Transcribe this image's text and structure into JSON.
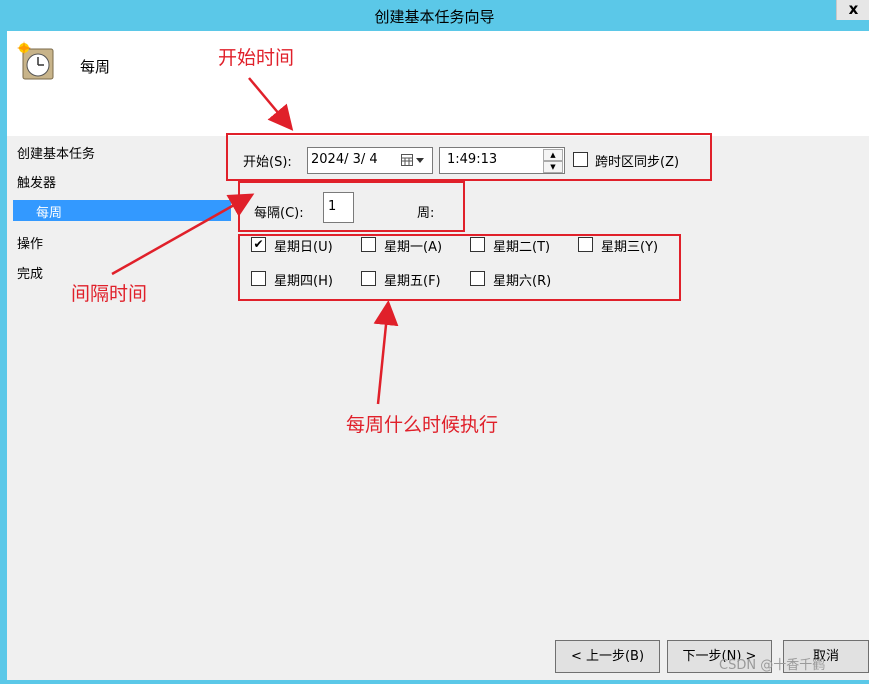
{
  "window": {
    "title": "创建基本任务向导",
    "close": "x"
  },
  "header": {
    "title": "每周"
  },
  "sidebar": {
    "items": [
      "创建基本任务",
      "触发器",
      "每周",
      "操作",
      "完成"
    ]
  },
  "start": {
    "label": "开始(S):",
    "date": "2024/  3/  4",
    "time": "1:49:13",
    "sync_label": "跨时区同步(Z)",
    "sync_checked": false
  },
  "interval": {
    "label": "每隔(C):",
    "value": "1",
    "unit": "周:"
  },
  "weekdays": [
    {
      "label": "星期日(U)",
      "checked": true
    },
    {
      "label": "星期一(A)",
      "checked": false
    },
    {
      "label": "星期二(T)",
      "checked": false
    },
    {
      "label": "星期三(Y)",
      "checked": false
    },
    {
      "label": "星期四(H)",
      "checked": false
    },
    {
      "label": "星期五(F)",
      "checked": false
    },
    {
      "label": "星期六(R)",
      "checked": false
    }
  ],
  "annotations": {
    "start_time": "开始时间",
    "interval_time": "间隔时间",
    "weekly_when": "每周什么时候执行"
  },
  "buttons": {
    "back": "< 上一步(B)",
    "next": "下一步(N) >",
    "cancel": "取消"
  },
  "watermark": "CSDN @十香千鹤",
  "colors": {
    "titlebar": "#5bc8e8",
    "selection": "#3399ff",
    "annotation": "#e0202a"
  }
}
